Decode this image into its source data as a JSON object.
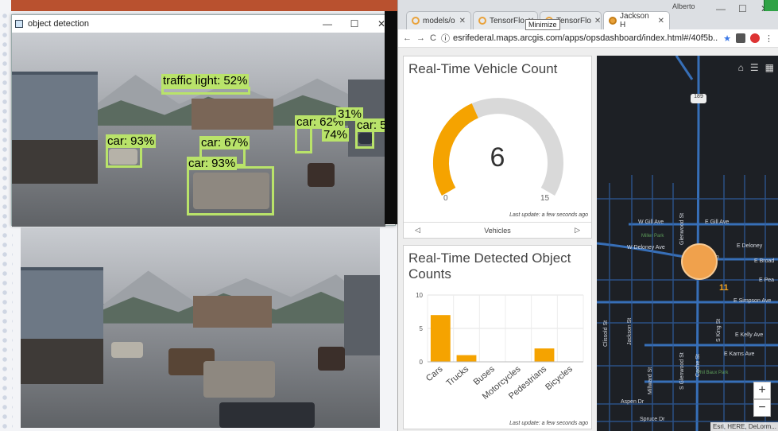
{
  "desktop": {},
  "od_window": {
    "title": "object detection",
    "buttons": {
      "minimize": "—",
      "maximize": "☐",
      "close": "✕"
    },
    "detections": [
      {
        "label": "traffic light: 52%"
      },
      {
        "label": "car: 93%"
      },
      {
        "label": "car: 67%"
      },
      {
        "label": "car: 93%"
      },
      {
        "label": "car: 62%"
      },
      {
        "label": "car: 5"
      },
      {
        "label": "31%"
      },
      {
        "label": "74%"
      }
    ]
  },
  "browser": {
    "profile": "Alberto",
    "tooltip": "Minimize",
    "tabs": [
      {
        "label": "models/o"
      },
      {
        "label": "TensorFlo"
      },
      {
        "label": "TensorFlo"
      },
      {
        "label": "Jackson H"
      }
    ],
    "tab_close": "✕",
    "url": "esrifederal.maps.arcgis.com/apps/opsdashboard/index.html#/40f5b...",
    "window_buttons": {
      "minimize": "—",
      "maximize": "☐",
      "close": "✕"
    },
    "nav": {
      "back": "←",
      "forward": "→",
      "reload": "C",
      "info": "ⓘ",
      "star": "★",
      "menu": "⋮"
    }
  },
  "dashboard": {
    "gauge_panel": {
      "title": "Real-Time Vehicle Count",
      "value": "6",
      "min": "0",
      "max": "15",
      "fraction": 0.4,
      "last_update": "Last update: a few seconds ago",
      "pager_label": "Vehicles",
      "prev": "◁",
      "next": "▷"
    },
    "bar_panel": {
      "title": "Real-Time Detected Object Counts",
      "last_update": "Last update: a few seconds ago"
    },
    "map": {
      "tools": {
        "home": "⌂",
        "list": "☰",
        "basemap": "▦"
      },
      "cluster_count": "11",
      "zoom_in": "+",
      "zoom_out": "−",
      "attribution": "Esri, HERE, DeLorm...",
      "streets_h": [
        {
          "label": "W Gill Ave"
        },
        {
          "label": "E Gill Ave"
        },
        {
          "label": "W Deloney Ave"
        },
        {
          "label": "E Deloney"
        },
        {
          "label": "E Broad"
        },
        {
          "label": "E Pea"
        },
        {
          "label": "E Simpson Ave"
        },
        {
          "label": "E Kelly Ave"
        },
        {
          "label": "E Karns Ave"
        },
        {
          "label": "Aspen Dr"
        },
        {
          "label": "Spruce Dr"
        },
        {
          "label": "Miller Park"
        },
        {
          "label": "Phil Baux Park"
        },
        {
          "label": "on"
        }
      ],
      "streets_v": [
        {
          "label": "Glenwood St"
        },
        {
          "label": "Clissold St"
        },
        {
          "label": "Jackson St"
        },
        {
          "label": "Millward St"
        },
        {
          "label": "S Glenwood St"
        },
        {
          "label": "Cache St"
        },
        {
          "label": "S King St"
        }
      ],
      "route_badge": "189"
    }
  },
  "chart_data": {
    "type": "bar",
    "categories": [
      "Cars",
      "Trucks",
      "Buses",
      "Motorcycles",
      "Pedestrians",
      "Bicycles"
    ],
    "values": [
      7,
      1,
      0,
      0,
      2,
      0
    ],
    "ylim": [
      0,
      10
    ],
    "yticks": [
      0,
      5,
      10
    ],
    "grid": true,
    "color": "#f5a300"
  },
  "colors": {
    "accent": "#f5a300",
    "gauge_track": "#d9d9d9",
    "detection": "#b9e36a",
    "map_bg": "#1d2025",
    "map_roads": "#3a78c9"
  }
}
